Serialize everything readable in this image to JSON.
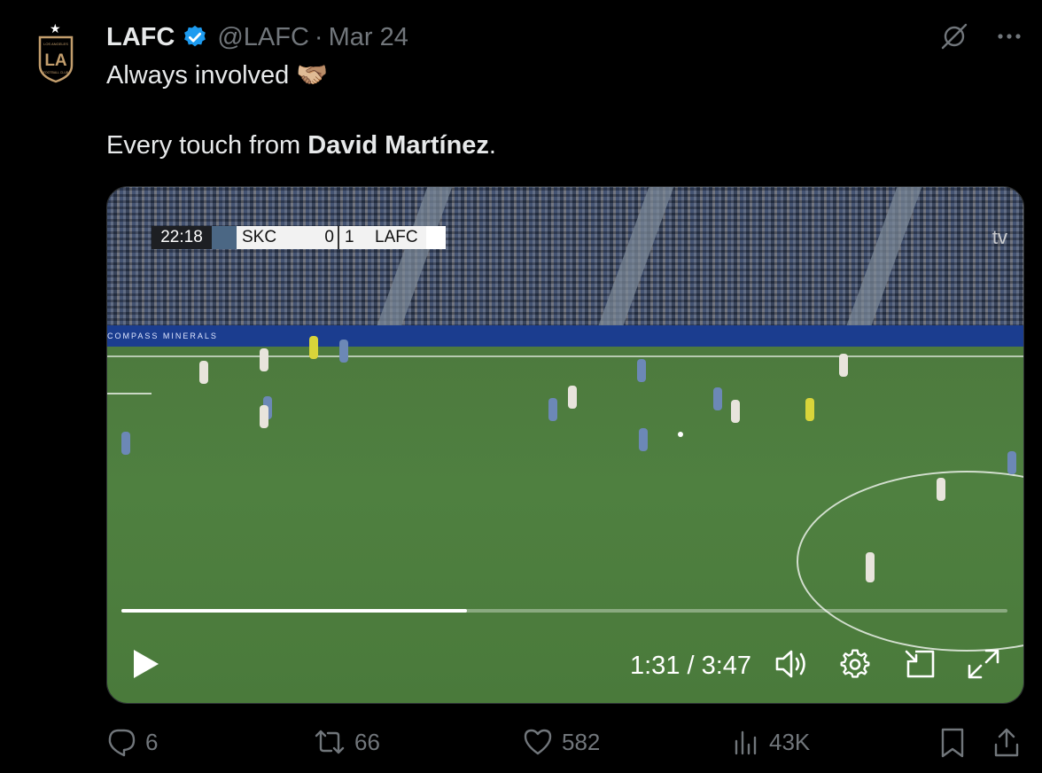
{
  "tweet": {
    "author_name": "LAFC",
    "handle": "@LAFC",
    "separator": "·",
    "date": "Mar 24",
    "line1_text": "Always involved 🫱🏼‍🫲🏽",
    "line2_prefix": "Every touch from ",
    "line2_bold": "David Martínez",
    "line2_suffix": "."
  },
  "video": {
    "scorebug": {
      "clock": "22:18",
      "home_team": "SKC",
      "home_score": "0",
      "away_score": "1",
      "away_team": "LAFC"
    },
    "broadcaster_logo": "tv",
    "adboard_text": "COMPASS MINERALS",
    "time_display": "1:31 / 3:47",
    "progress_fraction": 0.39
  },
  "actions": {
    "replies": "6",
    "reposts": "66",
    "likes": "582",
    "views": "43K"
  },
  "icons": {
    "verified": "verified-badge-icon",
    "grok": "grok-icon",
    "more": "more-icon",
    "reply": "reply-icon",
    "repost": "repost-icon",
    "like": "like-icon",
    "views": "views-icon",
    "bookmark": "bookmark-icon",
    "share": "share-icon",
    "play": "play-icon",
    "volume": "volume-icon",
    "settings": "settings-icon",
    "dock": "dock-icon",
    "fullscreen": "fullscreen-icon"
  },
  "colors": {
    "background": "#000000",
    "text": "#e7e9ea",
    "muted": "#71767b",
    "verified_blue": "#1d9bf0",
    "crest_gold": "#c39e6d"
  }
}
